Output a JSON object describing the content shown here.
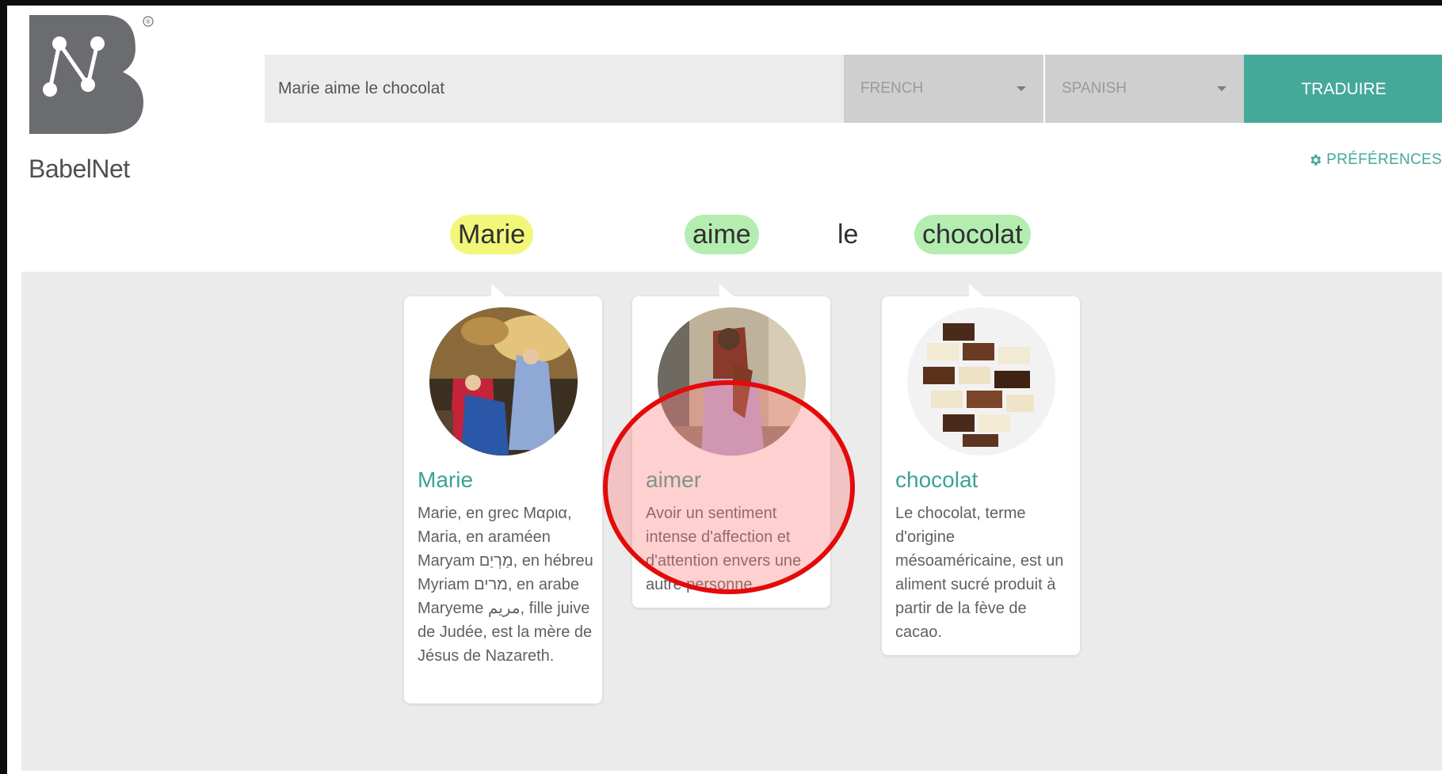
{
  "logo": {
    "text": "BabelNet",
    "registered": "®",
    "brand_color": "#6b6c70"
  },
  "search": {
    "value": "Marie aime le chocolat",
    "placeholder": ""
  },
  "source_language": {
    "selected": "FRENCH"
  },
  "target_language": {
    "selected": "SPANISH"
  },
  "translate_button": {
    "label": "TRADUIRE",
    "color": "#45a99a"
  },
  "preferences": {
    "label": "PRÉFÉRENCES",
    "icon": "gear-icon"
  },
  "words": [
    {
      "text": "Marie",
      "highlight": "#f2f77a"
    },
    {
      "text": "aime",
      "highlight": "#b4edb0"
    },
    {
      "text": "le",
      "highlight": ""
    },
    {
      "text": "chocolat",
      "highlight": "#b4edb0"
    }
  ],
  "cards": [
    {
      "title": "Marie",
      "image": "annunciation-painting",
      "text": "Marie, en grec Μαρια, Maria, en araméen Maryam מַרְיַם, en hébreu Myriam מרים, en arabe Maryeme مريم, fille juive de Judée, est la mère de Jésus de Nazareth."
    },
    {
      "title": "aimer",
      "image": "kiss-painting",
      "text": "Avoir un sentiment intense d'affection et d'attention envers une autre personne."
    },
    {
      "title": "chocolat",
      "image": "chocolate-pieces",
      "text": "Le chocolat, terme d'origine mésoaméricaine, est un aliment sucré produit à partir de la fève de cacao."
    }
  ],
  "annotation": {
    "shape": "red-ellipse",
    "target": "aimer card",
    "color": "#e40a0a"
  }
}
